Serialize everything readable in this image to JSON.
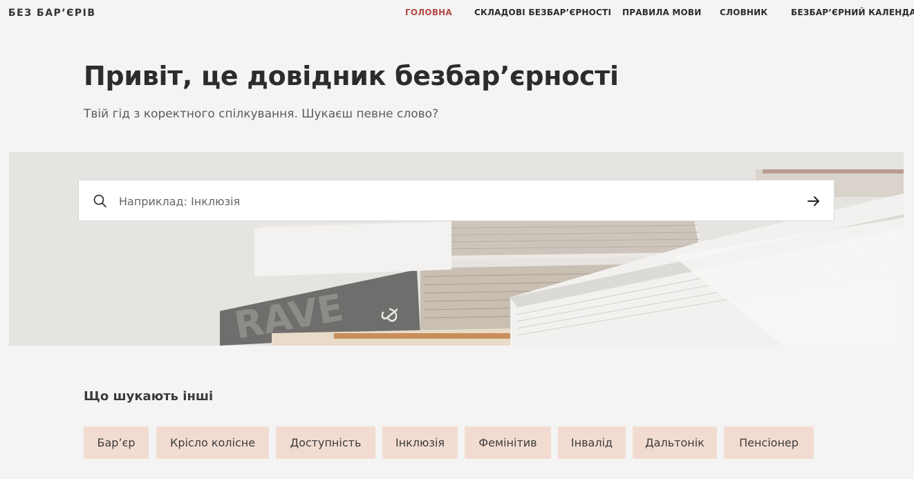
{
  "header": {
    "logo": "БЕЗ БАР’ЄРІВ",
    "nav": [
      {
        "label": "ГОЛОВНА",
        "active": true
      },
      {
        "label": "СКЛАДОВІ БЕЗБАР’ЄРНОСТІ",
        "active": false
      },
      {
        "label": "ПРАВИЛА МОВИ",
        "active": false
      },
      {
        "label": "СЛОВНИК",
        "active": false
      },
      {
        "label": "БЕЗБАР’ЄРНИЙ КАЛЕНДАР",
        "active": false
      }
    ]
  },
  "hero": {
    "title": "Привіт, це довідник безбар’єрності",
    "subtitle": "Твій гід з коректного спілкування. Шукаєш певне слово?"
  },
  "search": {
    "placeholder": "Наприклад: Інклюзія",
    "value": "",
    "icon": "search-icon",
    "submit_icon": "arrow-right-icon"
  },
  "popular": {
    "title": "Що шукають інші",
    "tags": [
      "Бар’єр",
      "Крісло колісне",
      "Доступність",
      "Інклюзія",
      "Фемінітив",
      "Інвалід",
      "Дальтонік",
      "Пенсіонер"
    ]
  },
  "colors": {
    "accent": "#b14a45",
    "tag_bg": "#f2dcd1",
    "page_bg": "#f4f4f4"
  }
}
